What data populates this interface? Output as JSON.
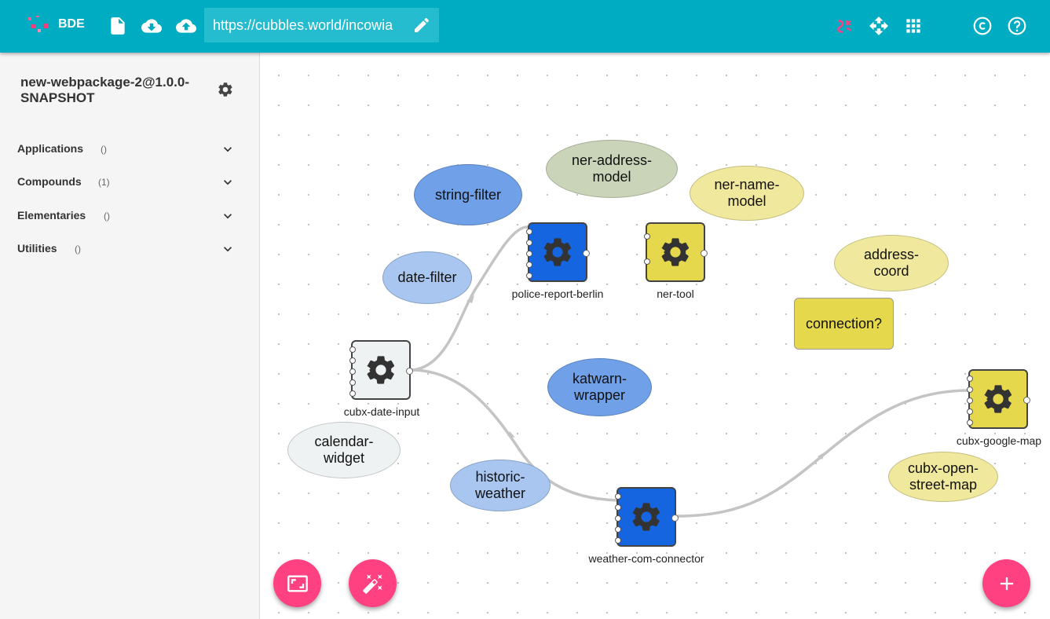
{
  "app": {
    "brand": "BDE",
    "url": "https://cubbles.world/incowia"
  },
  "sidebar": {
    "package_title": "new-webpackage-2@1.0.0-SNAPSHOT",
    "categories": [
      {
        "label": "Applications",
        "count": "()"
      },
      {
        "label": "Compounds",
        "count": "(1)"
      },
      {
        "label": "Elementaries",
        "count": "()"
      },
      {
        "label": "Utilities",
        "count": "()"
      }
    ]
  },
  "canvas": {
    "ellipses": [
      {
        "label": "string-filter",
        "color": "#6fa0e8"
      },
      {
        "label": "ner-address-model",
        "color": "#c9d4b8"
      },
      {
        "label": "ner-name-model",
        "color": "#f0e89c"
      },
      {
        "label": "date-filter",
        "color": "#a8c6f0"
      },
      {
        "label": "address-coord",
        "color": "#f0e89c"
      },
      {
        "label": "katwarn-wrapper",
        "color": "#6fa0e8"
      },
      {
        "label": "calendar-widget",
        "color": "#eef2f2"
      },
      {
        "label": "historic-weather",
        "color": "#a8c6f0"
      },
      {
        "label": "cubx-open-street-map",
        "color": "#f0e89c"
      }
    ],
    "rect_nodes": [
      {
        "label": "connection?",
        "color": "#e6d84c"
      }
    ],
    "components": [
      {
        "label": "police-report-berlin",
        "color": "#1565e0"
      },
      {
        "label": "ner-tool",
        "color": "#e6d84c"
      },
      {
        "label": "cubx-date-input",
        "color": "#eef2f2"
      },
      {
        "label": "cubx-google-map",
        "color": "#e6d84c"
      },
      {
        "label": "weather-com-connector",
        "color": "#1565e0"
      }
    ]
  },
  "colors": {
    "topbar": "#00acc1",
    "accent": "#ff4081",
    "logo_pink": "#f06292"
  }
}
